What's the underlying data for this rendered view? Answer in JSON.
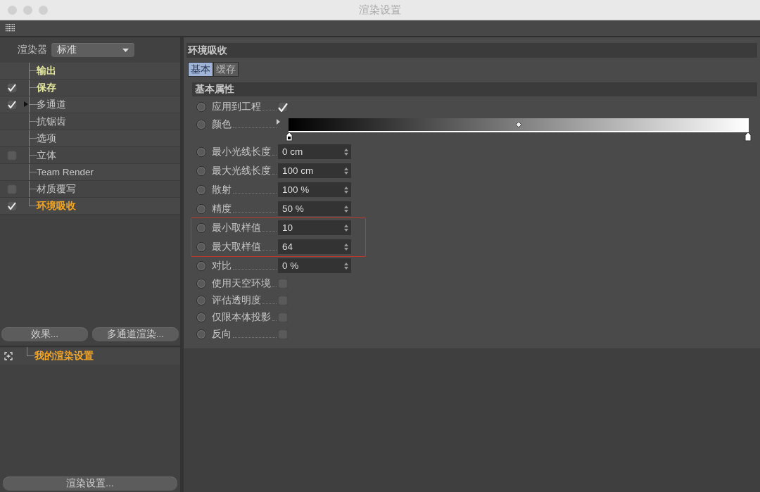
{
  "window": {
    "title": "渲染设置"
  },
  "renderer": {
    "label": "渲染器",
    "value": "标准"
  },
  "sidebar": {
    "items": [
      {
        "label": "输出",
        "kind": "plain",
        "highlight": true,
        "selected": false
      },
      {
        "label": "保存",
        "kind": "check",
        "checked": true,
        "highlight": true,
        "selected": false
      },
      {
        "label": "多通道",
        "kind": "check",
        "checked": true,
        "highlight": false,
        "selected": false,
        "expanded": false
      },
      {
        "label": "抗锯齿",
        "kind": "plain",
        "highlight": false,
        "selected": false
      },
      {
        "label": "选项",
        "kind": "plain",
        "highlight": false,
        "selected": false
      },
      {
        "label": "立体",
        "kind": "check",
        "checked": false,
        "highlight": false,
        "selected": false
      },
      {
        "label": "Team Render",
        "kind": "plain",
        "highlight": false,
        "selected": false
      },
      {
        "label": "材质覆写",
        "kind": "check",
        "checked": false,
        "highlight": false,
        "selected": false
      },
      {
        "label": "环境吸收",
        "kind": "check",
        "checked": true,
        "highlight": false,
        "selected": true
      }
    ]
  },
  "sidebar_buttons": [
    "效果...",
    "多通道渲染..."
  ],
  "settings_tree": [
    {
      "label": "我的渲染设置",
      "selected": true
    }
  ],
  "bottom_button": "渲染设置...",
  "panel": {
    "title": "环境吸收",
    "tabs": [
      {
        "label": "基本",
        "selected": true
      },
      {
        "label": "缓存",
        "selected": false
      }
    ],
    "section": "基本属性",
    "params": [
      {
        "label": "应用到工程",
        "kind": "checkbox",
        "checked": true,
        "highlighted": false,
        "animated": false
      },
      {
        "label": "颜色",
        "kind": "gradient",
        "highlighted": false,
        "animated": false
      },
      {
        "label": "最小光线长度",
        "kind": "field",
        "value": "0 cm",
        "highlighted": false,
        "animated": false
      },
      {
        "label": "最大光线长度",
        "kind": "field",
        "value": "100 cm",
        "highlighted": false,
        "animated": false
      },
      {
        "label": "散射",
        "kind": "field",
        "value": "100 %",
        "highlighted": false,
        "animated": false
      },
      {
        "label": "精度",
        "kind": "field",
        "value": "50 %",
        "highlighted": false,
        "animated": false
      },
      {
        "label": "最小取样值",
        "kind": "field",
        "value": "10",
        "highlighted": true,
        "animated": false
      },
      {
        "label": "最大取样值",
        "kind": "field",
        "value": "64",
        "highlighted": true,
        "animated": false
      },
      {
        "label": "对比",
        "kind": "field",
        "value": "0 %",
        "highlighted": false,
        "animated": false
      },
      {
        "label": "使用天空环境",
        "kind": "checkbox",
        "checked": false,
        "highlighted": false,
        "animated": false
      },
      {
        "label": "评估透明度",
        "kind": "checkbox",
        "checked": false,
        "highlighted": false,
        "animated": false
      },
      {
        "label": "仅限本体投影",
        "kind": "checkbox",
        "checked": false,
        "highlighted": false,
        "animated": false
      },
      {
        "label": "反向",
        "kind": "checkbox",
        "checked": false,
        "highlighted": false,
        "animated": false
      }
    ]
  }
}
